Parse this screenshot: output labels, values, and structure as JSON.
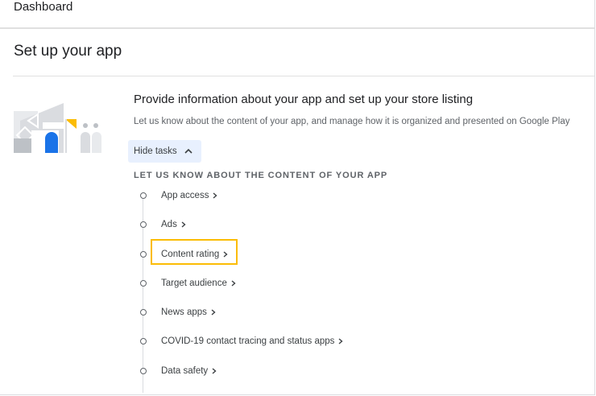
{
  "topbar": {
    "title": "Dashboard"
  },
  "page": {
    "title": "Set up your app"
  },
  "section": {
    "heading": "Provide information about your app and set up your store listing",
    "description": "Let us know about the content of your app, and manage how it is organized and presented on Google Play",
    "toggle_label": "Hide tasks",
    "toggle_icon": "chevron-up-icon",
    "group_label": "LET US KNOW ABOUT THE CONTENT OF YOUR APP"
  },
  "tasks": [
    {
      "label": "App access"
    },
    {
      "label": "Ads"
    },
    {
      "label": "Content rating",
      "highlighted": true
    },
    {
      "label": "Target audience"
    },
    {
      "label": "News apps"
    },
    {
      "label": "COVID-19 contact tracing and status apps"
    },
    {
      "label": "Data safety"
    }
  ],
  "colors": {
    "accent_blue": "#1a73e8",
    "highlight_yellow": "#fbbc04",
    "toggle_bg": "#e8f0fe"
  }
}
